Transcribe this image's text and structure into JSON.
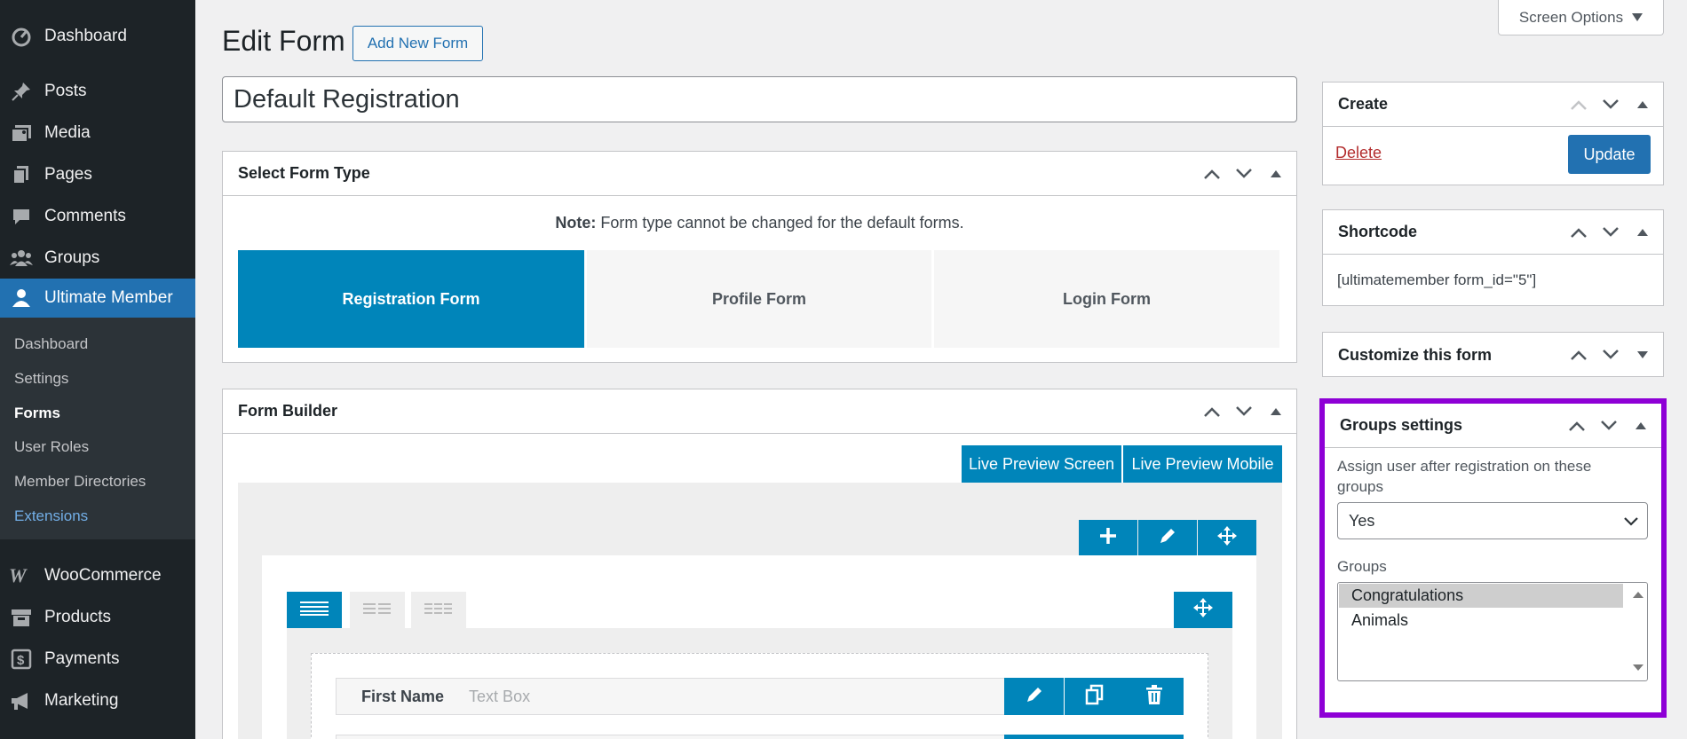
{
  "sidebar": {
    "items": [
      {
        "label": "Dashboard",
        "icon": "dashboard-icon"
      },
      {
        "label": "Posts",
        "icon": "pin-icon"
      },
      {
        "label": "Media",
        "icon": "media-icon"
      },
      {
        "label": "Pages",
        "icon": "pages-icon"
      },
      {
        "label": "Comments",
        "icon": "comments-icon"
      },
      {
        "label": "Groups",
        "icon": "groups-icon"
      },
      {
        "label": "Ultimate Member",
        "icon": "user-icon"
      }
    ],
    "submenu": [
      "Dashboard",
      "Settings",
      "Forms",
      "User Roles",
      "Member Directories",
      "Extensions"
    ],
    "lower_items": [
      {
        "label": "WooCommerce",
        "icon": "woocommerce-icon"
      },
      {
        "label": "Products",
        "icon": "archive-icon"
      },
      {
        "label": "Payments",
        "icon": "dollar-icon"
      },
      {
        "label": "Marketing",
        "icon": "megaphone-icon"
      }
    ]
  },
  "header": {
    "title": "Edit Form",
    "add_new": "Add New Form",
    "screen_options": "Screen Options"
  },
  "form_title": "Default Registration",
  "form_type": {
    "heading": "Select Form Type",
    "note_label": "Note:",
    "note_text": " Form type cannot be changed for the default forms.",
    "options": [
      "Registration Form",
      "Profile Form",
      "Login Form"
    ],
    "selected": "Registration Form"
  },
  "builder": {
    "heading": "Form Builder",
    "live_preview_screen": "Live Preview Screen",
    "live_preview_mobile": "Live Preview Mobile",
    "field": {
      "label": "First Name",
      "type": "Text Box"
    }
  },
  "create": {
    "heading": "Create",
    "delete": "Delete",
    "update": "Update"
  },
  "shortcode": {
    "heading": "Shortcode",
    "value": "[ultimatemember form_id=\"5\"]"
  },
  "customize": {
    "heading": "Customize this form"
  },
  "groups_settings": {
    "heading": "Groups settings",
    "assign_label": "Assign user after registration on these groups",
    "assign_value": "Yes",
    "groups_label": "Groups",
    "groups": [
      "Congratulations",
      "Animals"
    ],
    "selected_group": "Congratulations",
    "highlight_color": "#8e00d6"
  },
  "colors": {
    "sidebar_bg": "#1d2327",
    "accent": "#2271b1",
    "um_blue": "#0085ba"
  }
}
